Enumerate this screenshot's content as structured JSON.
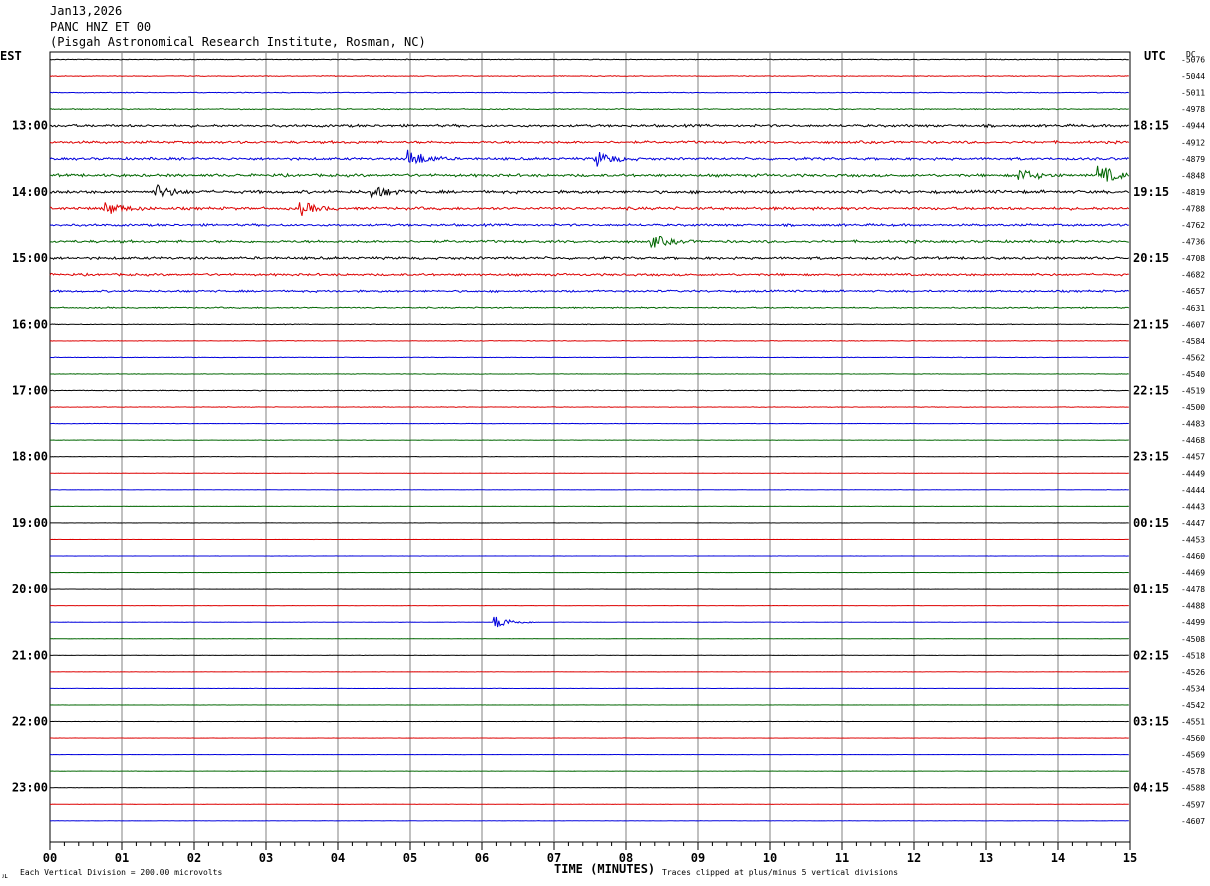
{
  "header": {
    "date": "Jan13,2026",
    "station": "PANC HNZ ET 00",
    "location": "(Pisgah Astronomical Research Institute, Rosman, NC)"
  },
  "left_zone_label": "EST",
  "right_zone_label": "UTC",
  "dc_label": "DC",
  "footer": {
    "scale": "Each Vertical Division =  200.00 microvolts",
    "xlabel": "TIME (MINUTES)",
    "clip": "Traces clipped at plus/minus 5 vertical divisions",
    "corner": "ᴊʟ"
  },
  "colors": {
    "black": "#000000",
    "red": "#dd0000",
    "blue": "#0000dd",
    "green": "#006600",
    "grid": "#808080"
  },
  "chart_data": {
    "type": "line",
    "title": "PANC HNZ ET 00",
    "xlabel": "TIME (MINUTES)",
    "x_ticks": [
      "00",
      "01",
      "02",
      "03",
      "04",
      "05",
      "06",
      "07",
      "08",
      "09",
      "10",
      "11",
      "12",
      "13",
      "14",
      "15"
    ],
    "xlim": [
      0,
      15
    ],
    "row_color_cycle": [
      "black",
      "red",
      "blue",
      "green"
    ],
    "est_labels": [
      "13:00",
      "14:00",
      "15:00",
      "16:00",
      "17:00",
      "18:00",
      "19:00",
      "20:00",
      "21:00",
      "22:00",
      "23:00"
    ],
    "utc_labels": [
      "18:15",
      "19:15",
      "20:15",
      "21:15",
      "22:15",
      "23:15",
      "00:15",
      "01:15",
      "02:15",
      "03:15",
      "04:15"
    ],
    "dc_offsets": [
      "-5076",
      "-5044",
      "-5011",
      "-4978",
      "-4944",
      "-4912",
      "-4879",
      "-4848",
      "-4819",
      "-4788",
      "-4762",
      "-4736",
      "-4708",
      "-4682",
      "-4657",
      "-4631",
      "-4607",
      "-4584",
      "-4562",
      "-4540",
      "-4519",
      "-4500",
      "-4483",
      "-4468",
      "-4457",
      "-4449",
      "-4444",
      "-4443",
      "-4447",
      "-4453",
      "-4460",
      "-4469",
      "-4478",
      "-4488",
      "-4499",
      "-4508",
      "-4518",
      "-4526",
      "-4534",
      "-4542",
      "-4551",
      "-4560",
      "-4569",
      "-4578",
      "-4588",
      "-4597",
      "-4607"
    ],
    "trace_activity": [
      0.15,
      0.15,
      0.15,
      0.2,
      0.5,
      0.5,
      0.5,
      0.55,
      0.6,
      0.55,
      0.45,
      0.5,
      0.5,
      0.45,
      0.4,
      0.25,
      0.12,
      0.12,
      0.1,
      0.1,
      0.15,
      0.12,
      0.08,
      0.07,
      0.06,
      0.05,
      0.05,
      0.05,
      0.04,
      0.04,
      0.04,
      0.04,
      0.04,
      0.04,
      0.05,
      0.05,
      0.05,
      0.05,
      0.05,
      0.05,
      0.05,
      0.05,
      0.05,
      0.05,
      0.05,
      0.05,
      0.05
    ],
    "events": [
      {
        "row": 6,
        "minute": 5.0,
        "amp": 3
      },
      {
        "row": 6,
        "minute": 7.6,
        "amp": 2.5
      },
      {
        "row": 7,
        "minute": 13.5,
        "amp": 2
      },
      {
        "row": 7,
        "minute": 14.6,
        "amp": 3
      },
      {
        "row": 8,
        "minute": 1.5,
        "amp": 2
      },
      {
        "row": 8,
        "minute": 4.5,
        "amp": 2
      },
      {
        "row": 9,
        "minute": 0.8,
        "amp": 2
      },
      {
        "row": 9,
        "minute": 3.5,
        "amp": 2
      },
      {
        "row": 11,
        "minute": 8.4,
        "amp": 1.8
      },
      {
        "row": 34,
        "minute": 6.2,
        "amp": 2.2
      }
    ]
  }
}
